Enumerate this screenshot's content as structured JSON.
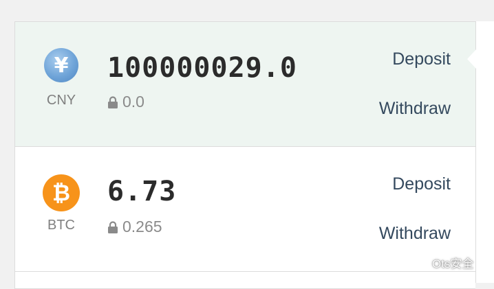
{
  "rows": [
    {
      "currency_code": "CNY",
      "icon": "yuan-coin-icon",
      "icon_glyph": "¥",
      "balance": "100000029.0",
      "locked": "0.0",
      "deposit_label": "Deposit",
      "withdraw_label": "Withdraw",
      "selected": true
    },
    {
      "currency_code": "BTC",
      "icon": "bitcoin-coin-icon",
      "icon_glyph": "₿",
      "balance": "6.73",
      "locked": "0.265",
      "deposit_label": "Deposit",
      "withdraw_label": "Withdraw",
      "selected": false
    }
  ],
  "watermark": {
    "text": "Ots安全",
    "icon": "wechat-icon"
  },
  "colors": {
    "selected_row_bg": "#eef5f1",
    "action_link": "#34495e",
    "btc_orange": "#f7931a",
    "cny_blue": "#6fa4d8"
  }
}
